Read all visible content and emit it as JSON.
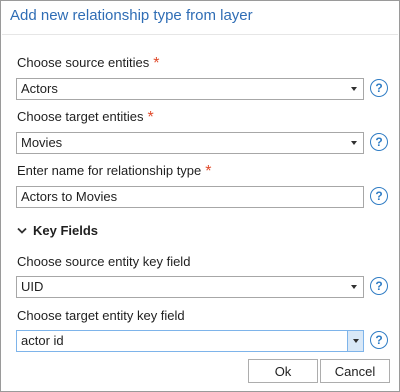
{
  "dialog": {
    "title": "Add new relationship type from layer"
  },
  "fields": {
    "source_entities": {
      "label": "Choose source entities",
      "required_mark": "*",
      "value": "Actors"
    },
    "target_entities": {
      "label": "Choose target entities",
      "required_mark": "*",
      "value": "Movies"
    },
    "relationship_name": {
      "label": "Enter name for relationship type",
      "required_mark": "*",
      "value": "Actors to Movies"
    }
  },
  "key_fields": {
    "heading": "Key Fields",
    "source_key": {
      "label": "Choose source entity key field",
      "value": "UID"
    },
    "target_key": {
      "label": "Choose target entity key field",
      "value": "actor id"
    }
  },
  "help_glyph": "?",
  "buttons": {
    "ok": "Ok",
    "cancel": "Cancel"
  },
  "colors": {
    "accent": "#2f6db5",
    "required": "#e0492a",
    "help": "#2f7cc4"
  }
}
